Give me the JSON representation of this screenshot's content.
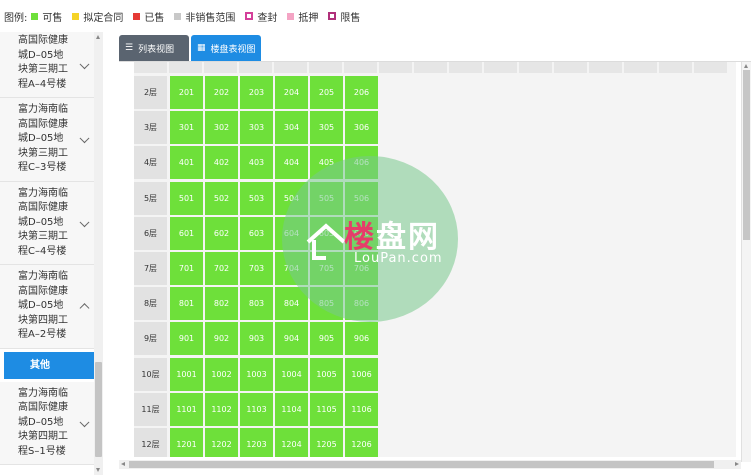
{
  "legend": {
    "title": "图例:",
    "items": [
      {
        "label": "可售",
        "color": "#6ee03a",
        "style": "solid"
      },
      {
        "label": "拟定合同",
        "color": "#f5d327",
        "style": "solid"
      },
      {
        "label": "已售",
        "color": "#e53935",
        "style": "solid"
      },
      {
        "label": "非销售范围",
        "color": "#c8c8c8",
        "style": "solid"
      },
      {
        "label": "查封",
        "color": "#d43f9a",
        "style": "hollow"
      },
      {
        "label": "抵押",
        "color": "#f4a4c4",
        "style": "solid"
      },
      {
        "label": "限售",
        "color": "#b0307a",
        "style": "hollow"
      }
    ]
  },
  "sidebar": {
    "items": [
      {
        "lines": [
          "高国际健康",
          "城D–05地",
          "块第三期工",
          "程A–4号楼"
        ],
        "expanded": false
      },
      {
        "lines": [
          "富力海南临",
          "高国际健康",
          "城D–05地",
          "块第三期工",
          "程C–3号楼"
        ],
        "expanded": false
      },
      {
        "lines": [
          "富力海南临",
          "高国际健康",
          "城D–05地",
          "块第三期工",
          "程C–4号楼"
        ],
        "expanded": false
      },
      {
        "lines": [
          "富力海南临",
          "高国际健康",
          "城D–05地",
          "块第四期工",
          "程A–2号楼"
        ],
        "expanded": true
      }
    ],
    "active_label": "其他",
    "after_items": [
      {
        "lines": [
          "富力海南临",
          "高国际健康",
          "城D–05地",
          "块第四期工",
          "程S–1号楼"
        ],
        "expanded": false
      }
    ]
  },
  "tabs": [
    {
      "label": "列表视图",
      "icon": "list-icon",
      "active": false
    },
    {
      "label": "楼盘表视图",
      "icon": "grid-icon",
      "active": true
    }
  ],
  "floors": [
    {
      "label": "2层",
      "units": [
        "201",
        "202",
        "203",
        "204",
        "205",
        "206"
      ]
    },
    {
      "label": "3层",
      "units": [
        "301",
        "302",
        "303",
        "304",
        "305",
        "306"
      ]
    },
    {
      "label": "4层",
      "units": [
        "401",
        "402",
        "403",
        "404",
        "405",
        "406"
      ]
    },
    {
      "label": "5层",
      "units": [
        "501",
        "502",
        "503",
        "504",
        "505",
        "506"
      ]
    },
    {
      "label": "6层",
      "units": [
        "601",
        "602",
        "603",
        "604",
        "605",
        "606"
      ]
    },
    {
      "label": "7层",
      "units": [
        "701",
        "702",
        "703",
        "704",
        "705",
        "706"
      ]
    },
    {
      "label": "8层",
      "units": [
        "801",
        "802",
        "803",
        "804",
        "805",
        "806"
      ]
    },
    {
      "label": "9层",
      "units": [
        "901",
        "902",
        "903",
        "904",
        "905",
        "906"
      ]
    },
    {
      "label": "10层",
      "units": [
        "1001",
        "1002",
        "1003",
        "1004",
        "1005",
        "1006"
      ]
    },
    {
      "label": "11层",
      "units": [
        "1101",
        "1102",
        "1103",
        "1104",
        "1105",
        "1106"
      ]
    },
    {
      "label": "12层",
      "units": [
        "1201",
        "1202",
        "1203",
        "1204",
        "1205",
        "1206"
      ]
    }
  ],
  "unit_status_color": "#6ee03a",
  "watermark": {
    "brand_first": "楼",
    "brand_rest": "盘网",
    "domain": "LouPan.com"
  }
}
